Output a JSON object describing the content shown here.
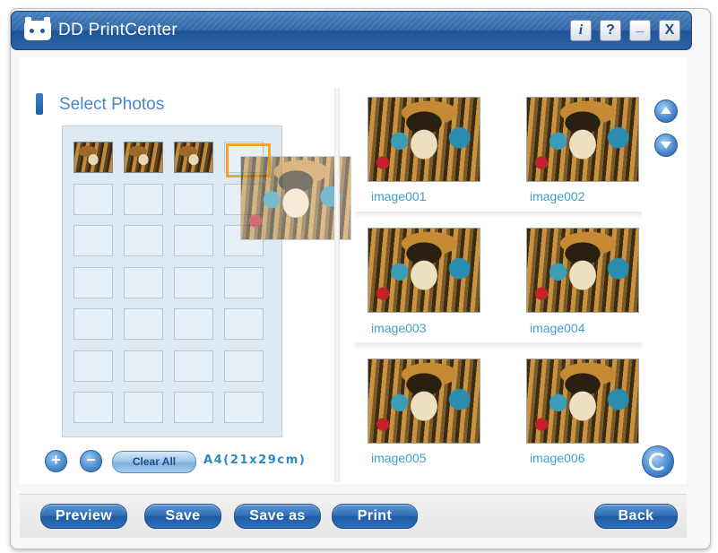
{
  "app": {
    "title": "DD PrintCenter",
    "window_buttons": {
      "info": "i",
      "help": "?",
      "minimize": "_",
      "close": "X"
    }
  },
  "select_panel": {
    "title": "Select Photos",
    "grid": {
      "columns": 4,
      "rows": 7,
      "filled_slots": 3
    },
    "controls": {
      "add": "+",
      "remove": "−",
      "clear_all": "Clear All"
    },
    "paper_size": "A4(21x29cm)"
  },
  "gallery": {
    "images": [
      {
        "caption": "image001"
      },
      {
        "caption": "image002"
      },
      {
        "caption": "image003"
      },
      {
        "caption": "image004"
      },
      {
        "caption": "image005"
      },
      {
        "caption": "image006"
      }
    ]
  },
  "bottom_bar": {
    "preview": "Preview",
    "save": "Save",
    "save_as": "Save as",
    "print": "Print",
    "back": "Back"
  },
  "colors": {
    "title_bar": "#2e67a8",
    "caption_text": "#3f9fc9",
    "drag_highlight": "#f4a428",
    "button_blue": "#2f6db4"
  },
  "icons": {
    "logo": "dd-logo-icon",
    "scroll_up": "arrow-up-icon",
    "scroll_down": "arrow-down-icon",
    "rotate": "rotate-icon"
  }
}
